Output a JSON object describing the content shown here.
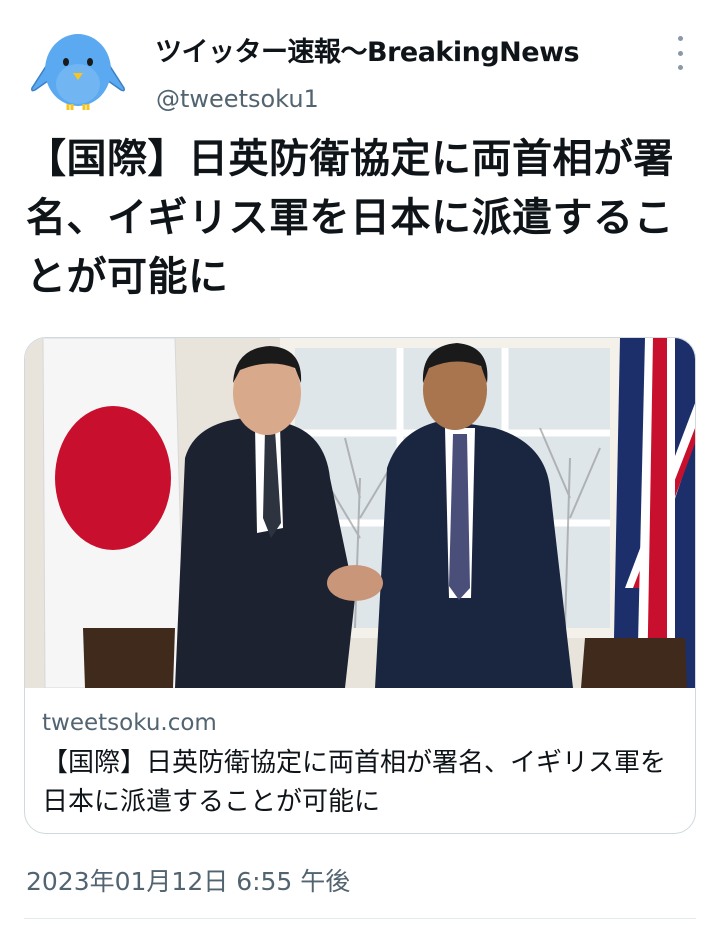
{
  "author": {
    "display_name": "ツイッター速報〜BreakingNews",
    "handle": "@tweetsoku1",
    "avatar_icon": "blue-bird-icon"
  },
  "tweet": {
    "text": "【国際】日英防衛協定に両首相が署名、イギリス軍を日本に派遣することが可能に",
    "timestamp": "2023年01月12日 6:55 午後"
  },
  "link_card": {
    "domain": "tweetsoku.com",
    "title": "【国際】日英防衛協定に両首相が署名、イギリス軍を日本に派遣することが可能に"
  },
  "colors": {
    "text_primary": "#0f1419",
    "text_secondary": "#536471",
    "border": "#cfd9de",
    "avatar_blue": "#5ba9f0"
  }
}
